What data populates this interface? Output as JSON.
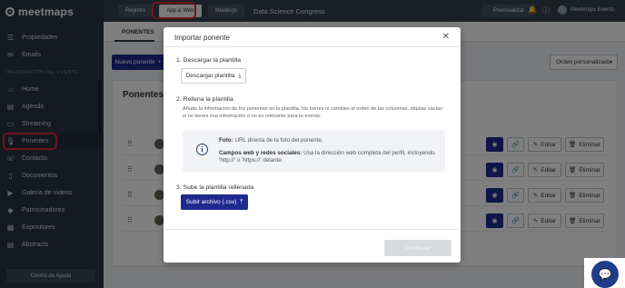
{
  "app": {
    "logo_text": "meetmaps"
  },
  "sidebar": {
    "top_items": [
      {
        "label": "Propiedades",
        "icon": "list-icon"
      },
      {
        "label": "Emails",
        "icon": "email-icon"
      }
    ],
    "section_label": "INFORMACIÓN DEL EVENTO",
    "items": [
      {
        "label": "Home",
        "icon": "home-icon"
      },
      {
        "label": "Agenda",
        "icon": "agenda-icon"
      },
      {
        "label": "Streaming",
        "icon": "streaming-icon"
      },
      {
        "label": "Ponentes",
        "icon": "microphone-icon"
      },
      {
        "label": "Contacto",
        "icon": "contact-icon"
      },
      {
        "label": "Documentos",
        "icon": "document-icon"
      },
      {
        "label": "Galería de vídeos",
        "icon": "video-icon"
      },
      {
        "label": "Patrocinadores",
        "icon": "sponsor-icon"
      },
      {
        "label": "Expositores",
        "icon": "exhibitor-icon"
      },
      {
        "label": "Abstracts",
        "icon": "abstract-icon"
      }
    ],
    "help_label": "Centro de Ayuda"
  },
  "topbar": {
    "tabs": [
      "Registro",
      "App & Web",
      "Meetings"
    ],
    "event_name": "Data Science Congress",
    "preview_label": "Previsualizar",
    "user_name": "Meetmaps Events"
  },
  "main": {
    "subtab_label": "PONENTES",
    "new_button_label": "Nuevo ponente",
    "order_label": "Orden personalizado",
    "card_title": "Ponentes",
    "row_actions": {
      "edit": "Editar",
      "delete": "Eliminar"
    },
    "row_count": 4
  },
  "modal": {
    "title": "Importar ponente",
    "step1_title": "1. Descargar la plantilla",
    "download_label": "Descargar plantilla",
    "step2_title": "2. Rellena la plantilla",
    "step2_desc": "Añade la información de los ponentes en la plantilla. No borres ni cambies el orden de las columnas, déjalas vacías si no tienes esa información o no es relevante para tu evento.",
    "info_photo_label": "Foto:",
    "info_photo_text": " URL directa de la foto del ponente.",
    "info_social_label": "Campos web y redes sociales:",
    "info_social_text": " Usa la dirección web completa del perfil, incluyendo 'http://' o 'https://' delante.",
    "step3_title": "3. Sube la plantilla rellenada",
    "upload_label": "Subir archivo (.csv)",
    "continue_label": "Continuar"
  },
  "colors": {
    "accent": "#1f2a8f",
    "highlight": "#e0263c",
    "sidebar_bg": "#2b3541"
  }
}
